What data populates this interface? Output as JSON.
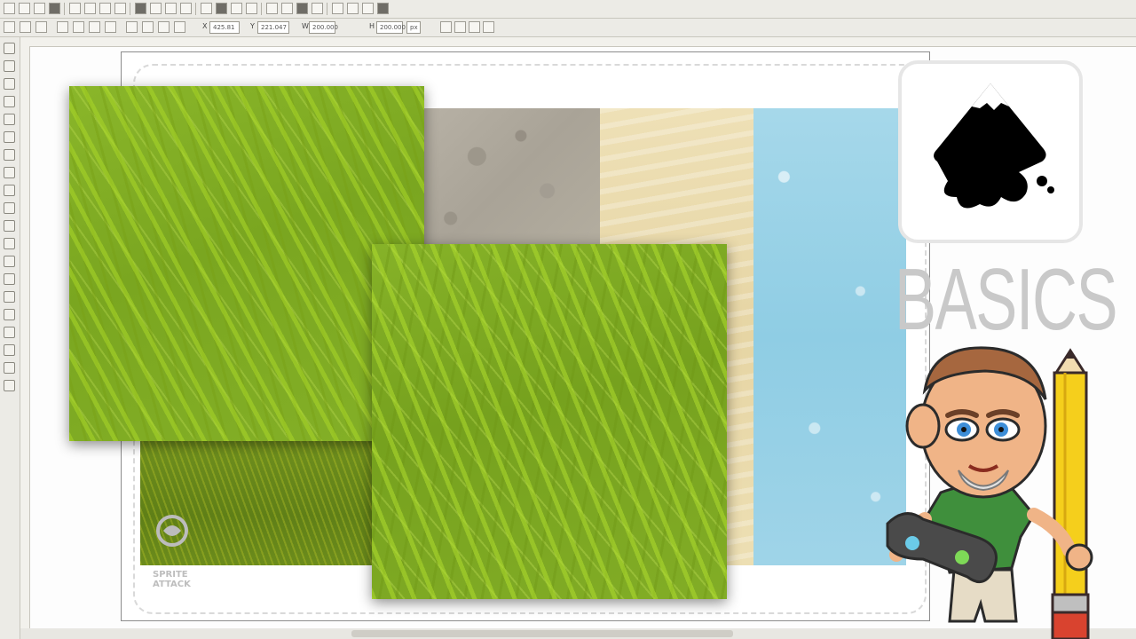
{
  "app": {
    "name": "Inkscape",
    "mode": "tiled-texture-demo"
  },
  "toolbar": {
    "icons": [
      "new-icon",
      "open-icon",
      "save-icon",
      "print-icon",
      "import-icon",
      "export-icon",
      "undo-icon",
      "redo-icon",
      "copy-icon",
      "cut-icon",
      "paste-icon",
      "zoom-selection-icon",
      "zoom-drawing-icon",
      "zoom-page-icon",
      "duplicate-icon",
      "clone-icon",
      "unlink-icon",
      "group-icon",
      "ungroup-icon",
      "fill-stroke-icon",
      "text-font-icon",
      "xml-editor-icon",
      "align-icon",
      "preferences-icon"
    ],
    "controls": {
      "x_label": "X",
      "x_value": "425.81",
      "y_label": "Y",
      "y_value": "221.047",
      "w_label": "W",
      "w_value": "200.000",
      "h_label": "H",
      "h_value": "200.000",
      "unit": "px"
    }
  },
  "toolbox": {
    "tools": [
      "selector-tool-icon",
      "node-tool-icon",
      "tweak-tool-icon",
      "zoom-tool-icon",
      "measure-tool-icon",
      "rectangle-tool-icon",
      "3d-box-tool-icon",
      "ellipse-tool-icon",
      "star-tool-icon",
      "spiral-tool-icon",
      "pencil-tool-icon",
      "pen-tool-icon",
      "calligraphy-tool-icon",
      "text-tool-icon",
      "spray-tool-icon",
      "eraser-tool-icon",
      "paint-bucket-tool-icon",
      "gradient-tool-icon",
      "dropper-tool-icon",
      "connector-tool-icon"
    ]
  },
  "canvas": {
    "textures": [
      "stone",
      "sand",
      "water",
      "photo-grass",
      "vector-grass-1",
      "vector-grass-2"
    ]
  },
  "watermark": {
    "line1": "SPRITE",
    "line2": "ATTACK"
  },
  "overlay": {
    "logo": "inkscape-logo-icon",
    "title": "BASICS",
    "mascot": "cartoon-character-with-pencil-and-controller"
  },
  "colors": {
    "grass": "#7fab24",
    "sand": "#eadbaa",
    "water": "#99d1e6",
    "stone": "#aea89b",
    "basics_text": "#c9c9c9",
    "toolbar_bg": "#ecebe6"
  }
}
